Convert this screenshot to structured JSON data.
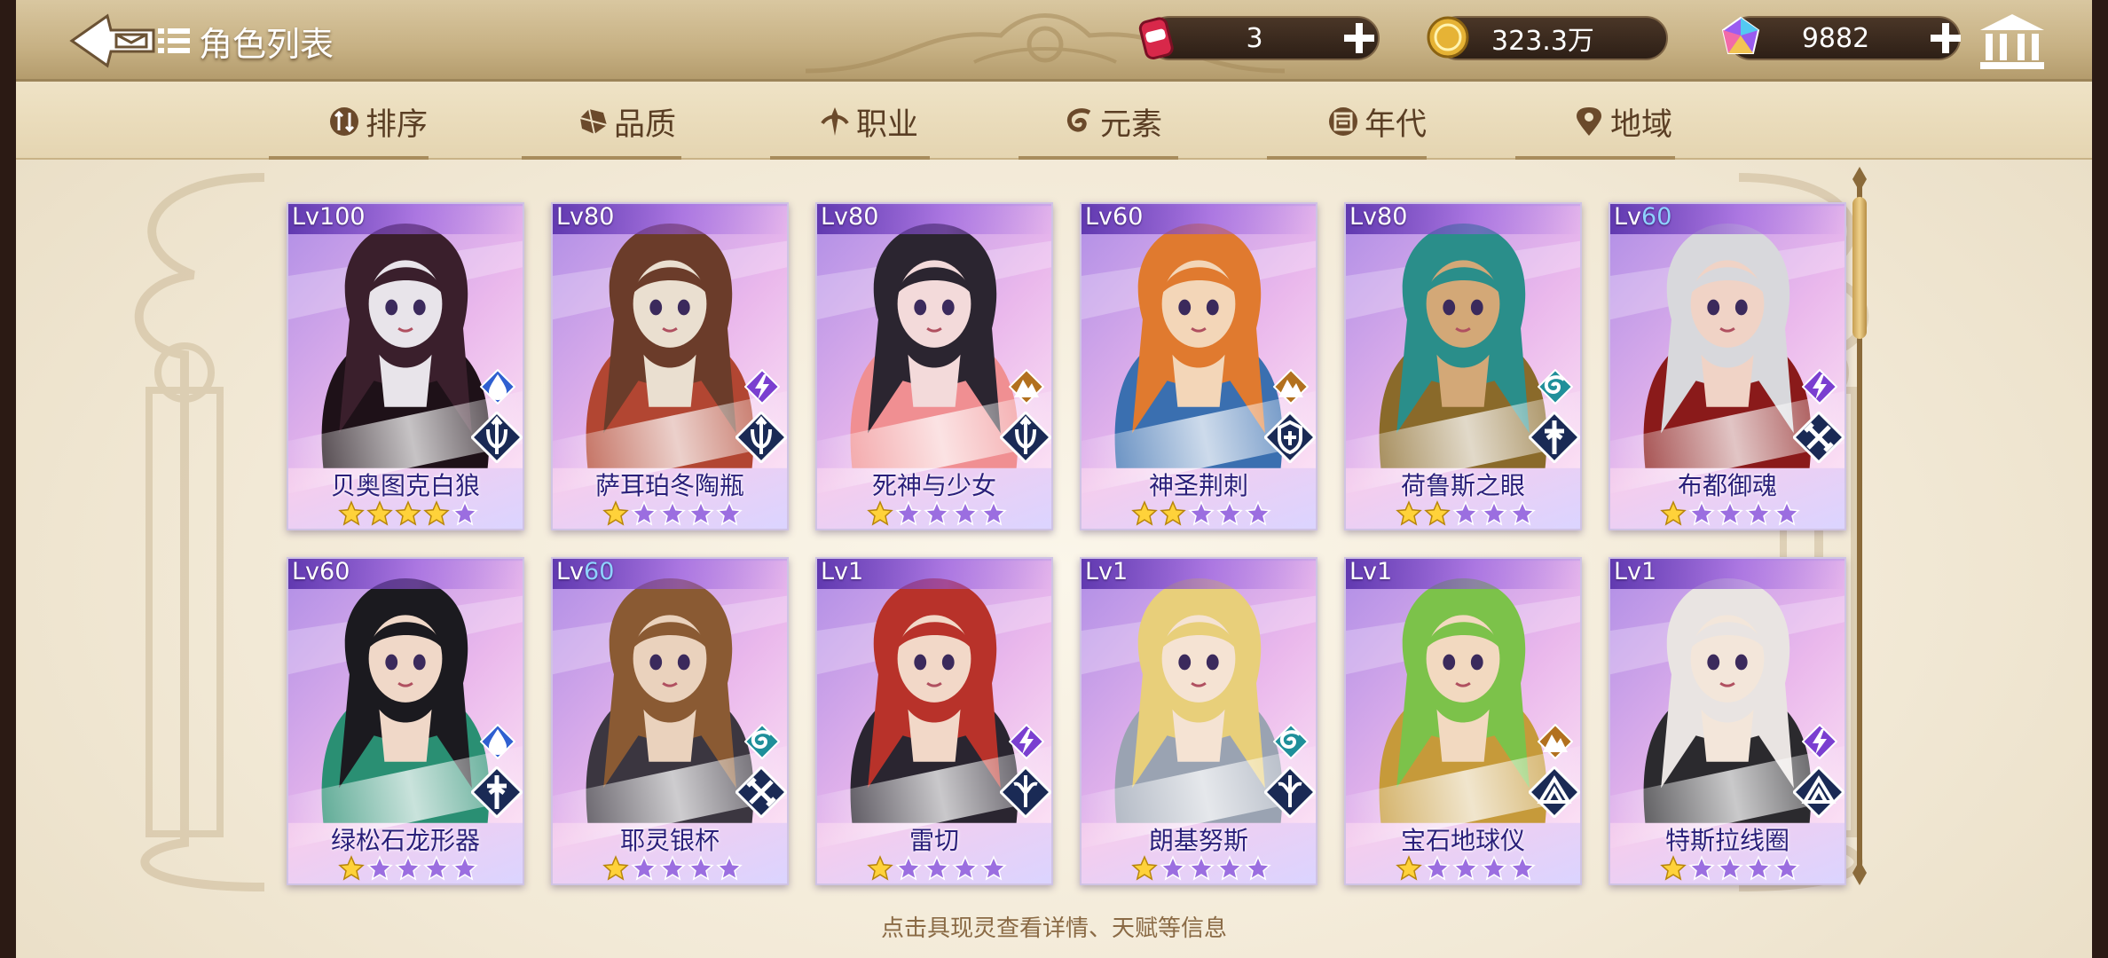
{
  "header": {
    "title": "角色列表",
    "resources": [
      {
        "key": "stamina",
        "value": "3"
      },
      {
        "key": "gold",
        "value": "323.3万"
      },
      {
        "key": "gem",
        "value": "9882"
      }
    ]
  },
  "tabs": [
    {
      "label": "排序",
      "icon": "sort-icon"
    },
    {
      "label": "品质",
      "icon": "gem-quality-icon"
    },
    {
      "label": "职业",
      "icon": "class-icon"
    },
    {
      "label": "元素",
      "icon": "element-icon"
    },
    {
      "label": "年代",
      "icon": "era-icon"
    },
    {
      "label": "地域",
      "icon": "location-pin-icon"
    }
  ],
  "characters": [
    {
      "name": "贝奥图克白狼",
      "lv_prefix": "Lv",
      "level": "100",
      "level_color": "white",
      "stars": 4,
      "element": "water",
      "class": "archer",
      "palette": [
        "#3a1f2c",
        "#1e1118",
        "#e8e4ea"
      ]
    },
    {
      "name": "萨耳珀冬陶瓶",
      "lv_prefix": "Lv",
      "level": "80",
      "level_color": "white",
      "stars": 1,
      "element": "thunder",
      "class": "archer",
      "palette": [
        "#6b3c2a",
        "#b24632",
        "#eadfd0"
      ]
    },
    {
      "name": "死神与少女",
      "lv_prefix": "Lv",
      "level": "80",
      "level_color": "white",
      "stars": 1,
      "element": "earth",
      "class": "archer",
      "palette": [
        "#2b2530",
        "#f08f92",
        "#f3dada"
      ]
    },
    {
      "name": "神圣荆刺",
      "lv_prefix": "Lv",
      "level": "60",
      "level_color": "white",
      "stars": 2,
      "element": "earth",
      "class": "guardian",
      "palette": [
        "#e07a2f",
        "#3a6fb0",
        "#f3d6b8"
      ]
    },
    {
      "name": "荷鲁斯之眼",
      "lv_prefix": "Lv",
      "level": "80",
      "level_color": "white",
      "stars": 2,
      "element": "wind",
      "class": "healer",
      "palette": [
        "#2a8e8a",
        "#8a6a2a",
        "#d3a877"
      ]
    },
    {
      "name": "布都御魂",
      "lv_prefix": "Lv",
      "level": "60",
      "level_color": "blue",
      "stars": 1,
      "element": "thunder",
      "class": "warrior",
      "palette": [
        "#d8d8dc",
        "#8a1a1a",
        "#f0d3c6"
      ]
    },
    {
      "name": "绿松石龙形器",
      "lv_prefix": "Lv",
      "level": "60",
      "level_color": "white",
      "stars": 1,
      "element": "water",
      "class": "healer",
      "palette": [
        "#1b1a1f",
        "#2a8f73",
        "#f0d8c8"
      ]
    },
    {
      "name": "耶灵银杯",
      "lv_prefix": "Lv",
      "level": "60",
      "level_color": "blue",
      "stars": 1,
      "element": "wind",
      "class": "warrior",
      "palette": [
        "#8a5a33",
        "#3b3640",
        "#ead2bd"
      ]
    },
    {
      "name": "雷切",
      "lv_prefix": "Lv",
      "level": "1",
      "level_color": "white",
      "stars": 1,
      "element": "thunder",
      "class": "assassin",
      "palette": [
        "#b8322a",
        "#2a2530",
        "#f2d8c8"
      ]
    },
    {
      "name": "朗基努斯",
      "lv_prefix": "Lv",
      "level": "1",
      "level_color": "white",
      "stars": 1,
      "element": "wind",
      "class": "assassin",
      "palette": [
        "#e8cf7a",
        "#9aa3b2",
        "#f5e3d3"
      ]
    },
    {
      "name": "宝石地球仪",
      "lv_prefix": "Lv",
      "level": "1",
      "level_color": "white",
      "stars": 1,
      "element": "earth",
      "class": "mage",
      "palette": [
        "#7cc24a",
        "#c69a3a",
        "#f2d9c0"
      ]
    },
    {
      "name": "特斯拉线圈",
      "lv_prefix": "Lv",
      "level": "1",
      "level_color": "white",
      "stars": 1,
      "element": "thunder",
      "class": "mage",
      "palette": [
        "#e9e4e2",
        "#2b2a2e",
        "#f3e6da"
      ]
    }
  ],
  "hint": "点击具现灵查看详情、天赋等信息",
  "colors": {
    "element_water": "#2f5fd0",
    "element_thunder": "#7a3fd0",
    "element_earth": "#b2701e",
    "element_wind": "#1f8f9a",
    "class_badge": "#1a2a55",
    "star_gold": "#ffd23a",
    "star_empty": "#9b6ee0"
  }
}
